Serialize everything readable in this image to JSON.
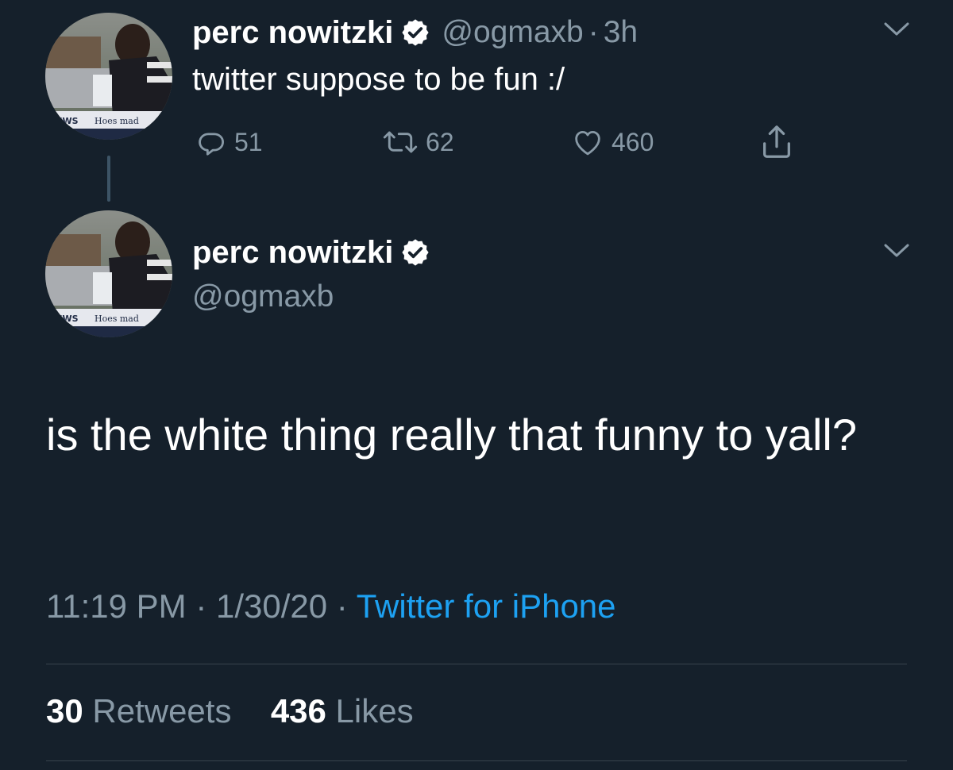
{
  "thread": {
    "tweet1": {
      "display_name": "perc nowitzki",
      "handle": "@ogmaxb",
      "separator": "·",
      "time": "3h",
      "text": "twitter suppose to be fun :/",
      "avatar_caption_left": "EWS",
      "avatar_caption_right": "Hoes mad",
      "actions": {
        "replies": "51",
        "retweets": "62",
        "likes": "460"
      }
    },
    "tweet2": {
      "display_name": "perc nowitzki",
      "handle": "@ogmaxb",
      "avatar_caption_left": "EWS",
      "avatar_caption_right": "Hoes mad",
      "text": "is the white thing really that funny to yall?",
      "meta": {
        "time": "11:19 PM",
        "separator1": " · ",
        "date": "1/30/20",
        "separator2": " · ",
        "source": "Twitter for iPhone"
      },
      "stats": {
        "retweets_count": "30",
        "retweets_label": " Retweets",
        "likes_count": "436",
        "likes_label": " Likes"
      }
    }
  },
  "colors": {
    "background": "#15202b",
    "text_primary": "#ffffff",
    "text_secondary": "#8899a6",
    "link": "#1da1f2",
    "divider": "#38444d"
  },
  "icons": [
    "reply-icon",
    "retweet-icon",
    "like-icon",
    "share-icon",
    "verified-badge-icon",
    "chevron-down-icon"
  ]
}
